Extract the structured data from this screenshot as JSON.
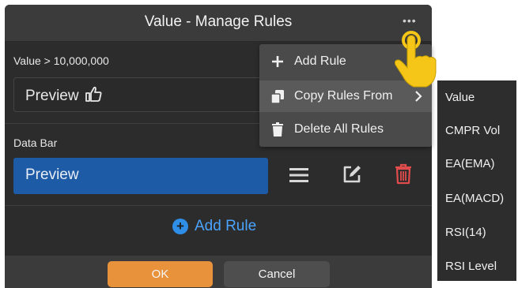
{
  "dialog": {
    "title": "Value - Manage Rules",
    "more_icon": "ellipsis-icon",
    "rules": [
      {
        "condition": "Value > 10,000,000",
        "preview": "Preview",
        "preview_icon": "thumbs-up-icon"
      },
      {
        "condition": "Data Bar",
        "preview": "Preview",
        "preview_color": "#1e5ba6"
      }
    ],
    "row_icons": [
      "hamburger-icon",
      "edit-icon",
      "trash-icon"
    ],
    "add_rule_label": "Add Rule",
    "ok_label": "OK",
    "cancel_label": "Cancel"
  },
  "menu": {
    "items": [
      {
        "label": "Add Rule",
        "icon": "plus-icon"
      },
      {
        "label": "Copy Rules From",
        "icon": "copy-icon",
        "has_submenu": true
      },
      {
        "label": "Delete All Rules",
        "icon": "trash-icon"
      }
    ]
  },
  "submenu": {
    "items": [
      "Value",
      "CMPR Vol",
      "EA(EMA)",
      "EA(MACD)",
      "RSI(14)",
      "RSI Level"
    ]
  },
  "colors": {
    "accent_blue": "#1e5ba6",
    "ok_orange": "#e8923b",
    "trash_red": "#e04b4b",
    "link_blue": "#4aa3ff"
  }
}
